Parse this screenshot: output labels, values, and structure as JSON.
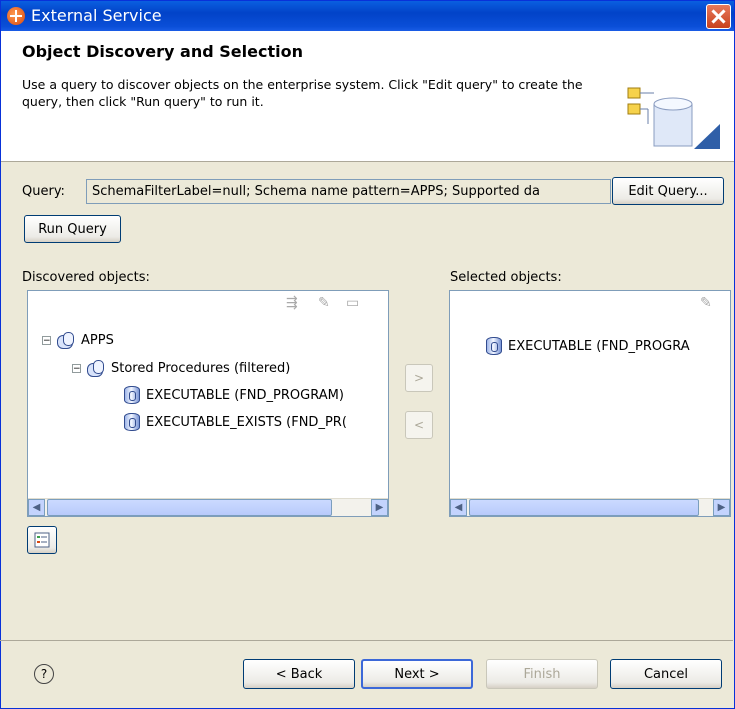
{
  "window": {
    "title": "External Service"
  },
  "header": {
    "title": "Object Discovery and Selection",
    "description": "Use a query to discover objects on the enterprise system.  Click \"Edit query\" to create the query, then click \"Run query\" to run it."
  },
  "query": {
    "label": "Query:",
    "value": "SchemaFilterLabel=null; Schema name pattern=APPS; Supported da",
    "edit_label": "Edit Query...",
    "run_label": "Run Query"
  },
  "discovered": {
    "label": "Discovered objects:",
    "tree": {
      "root": "APPS",
      "folder": "Stored Procedures (filtered)",
      "items": [
        "EXECUTABLE (FND_PROGRAM)",
        "EXECUTABLE_EXISTS (FND_PR("
      ]
    }
  },
  "selected": {
    "label": "Selected objects:",
    "items": [
      "EXECUTABLE (FND_PROGRA"
    ]
  },
  "buttons": {
    "add": ">",
    "remove": "<",
    "back": "< Back",
    "next": "Next >",
    "finish": "Finish",
    "cancel": "Cancel",
    "help": "?"
  },
  "colors": {
    "titlebar": "#0a4fd8",
    "dialog_bg": "#ece9d8",
    "focus_border": "#3c68d8"
  }
}
